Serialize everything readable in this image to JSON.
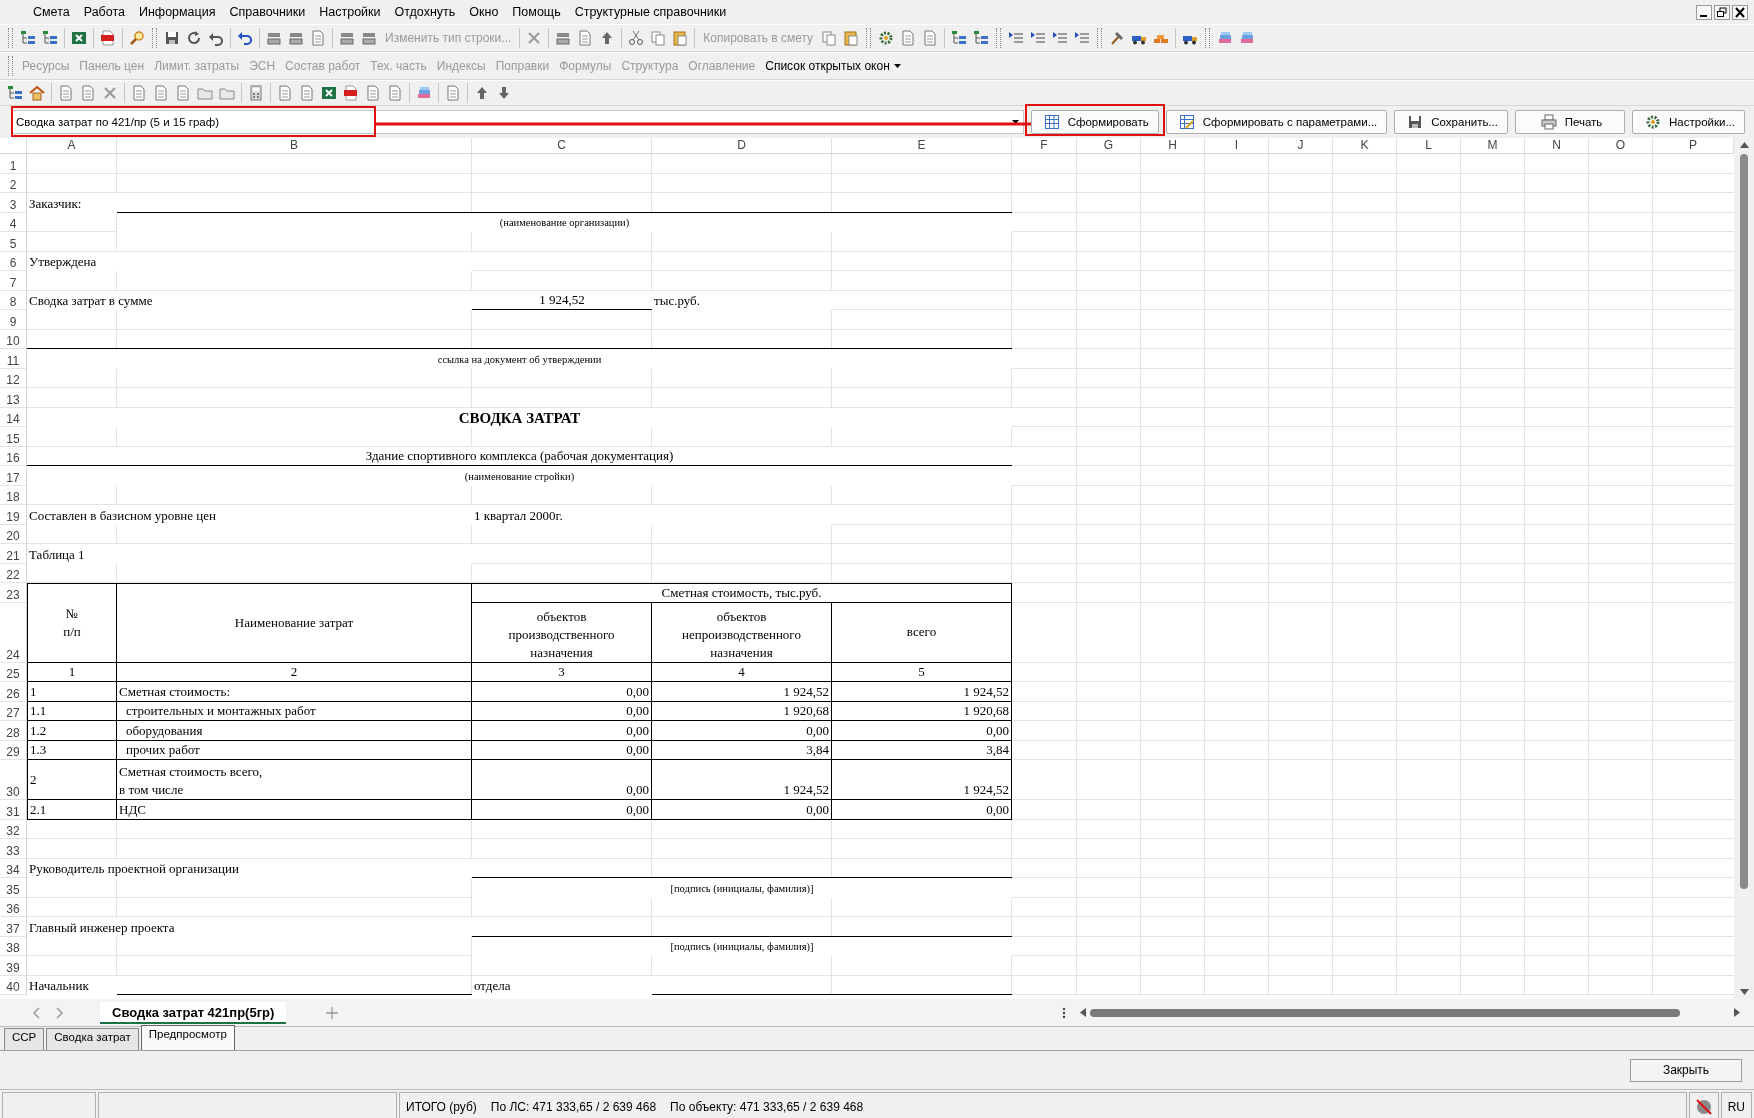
{
  "menu": [
    {
      "label": "Смета"
    },
    {
      "label": "Работа"
    },
    {
      "label": "Информация"
    },
    {
      "label": "Справочники"
    },
    {
      "label": "Настройки"
    },
    {
      "label": "Отдохнуть"
    },
    {
      "label": "Окно"
    },
    {
      "label": "Помощь"
    },
    {
      "label": "Структурные справочники"
    }
  ],
  "toolbar_main": [
    {
      "label": "Изменить тип строки...",
      "disabled": true
    },
    {
      "label": "Копировать в смету",
      "disabled": true
    }
  ],
  "toolbar_modules": [
    {
      "label": "Ресурсы",
      "disabled": true
    },
    {
      "label": "Панель цен",
      "disabled": true
    },
    {
      "label": "Лимит. затраты",
      "disabled": true
    },
    {
      "label": "ЭСН",
      "disabled": true
    },
    {
      "label": "Состав работ",
      "disabled": true
    },
    {
      "label": "Тех. часть",
      "disabled": true
    },
    {
      "label": "Индексы",
      "disabled": true
    },
    {
      "label": "Поправки",
      "disabled": true
    },
    {
      "label": "Формулы",
      "disabled": true
    },
    {
      "label": "Структура",
      "disabled": true
    },
    {
      "label": "Оглавление",
      "disabled": true
    },
    {
      "label": "Список открытых окон",
      "disabled": false
    }
  ],
  "report_selector": {
    "value": "Сводка затрат по 421/пр (5 и 15 граф)"
  },
  "report_buttons": [
    {
      "label": "Сформировать"
    },
    {
      "label": "Сформировать с параметрами..."
    },
    {
      "label": "Сохранить..."
    },
    {
      "label": "Печать"
    },
    {
      "label": "Настройки..."
    }
  ],
  "sheet": {
    "columns": [
      "A",
      "B",
      "C",
      "D",
      "E",
      "F",
      "G",
      "H",
      "I",
      "J",
      "K",
      "L",
      "M",
      "N",
      "O",
      "P"
    ],
    "rows": [
      {
        "number": "1"
      },
      {
        "number": "2"
      },
      {
        "number": "3",
        "cells": [
          "Заказчик:"
        ]
      },
      {
        "number": "4",
        "cells": [
          "(наименование организации)"
        ]
      },
      {
        "number": "5"
      },
      {
        "number": "6",
        "cells": [
          "Утверждена"
        ]
      },
      {
        "number": "7"
      },
      {
        "number": "8",
        "cells": [
          "Сводка затрат в сумме",
          "1 924,52",
          "тыс.руб."
        ]
      },
      {
        "number": "9"
      },
      {
        "number": "10"
      },
      {
        "number": "11",
        "cells": [
          "ссылка на документ об утверждении"
        ]
      },
      {
        "number": "12"
      },
      {
        "number": "13"
      },
      {
        "number": "14",
        "cells": [
          "СВОДКА ЗАТРАТ"
        ]
      },
      {
        "number": "15"
      },
      {
        "number": "16",
        "cells": [
          "Здание спортивного комплекса (рабочая документация)"
        ]
      },
      {
        "number": "17",
        "cells": [
          "(наименование стройки)"
        ]
      },
      {
        "number": "18"
      },
      {
        "number": "19",
        "cells": [
          "Составлен в базисном уровне цен",
          "1 квартал 2000г."
        ]
      },
      {
        "number": "20"
      },
      {
        "number": "21",
        "cells": [
          "Таблица 1"
        ]
      },
      {
        "number": "22"
      },
      {
        "number": "23",
        "cells": [
          "№\nп/п",
          "Наименование затрат",
          "Сметная стоимость, тыс.руб."
        ]
      },
      {
        "number": "24",
        "cells": [
          "объектов\nпроизводственного\nназначения",
          "объектов\nнепроизводственного\nназначения",
          "всего"
        ]
      },
      {
        "number": "25",
        "cells": [
          "1",
          "2",
          "3",
          "4",
          "5"
        ]
      },
      {
        "number": "26",
        "cells": [
          "1",
          "Сметная стоимость:",
          "0,00",
          "1 924,52",
          "1 924,52"
        ]
      },
      {
        "number": "27",
        "cells": [
          "1.1",
          "строительных и монтажных работ",
          "0,00",
          "1 920,68",
          "1 920,68"
        ]
      },
      {
        "number": "28",
        "cells": [
          "1.2",
          "оборудования",
          "0,00",
          "0,00",
          "0,00"
        ]
      },
      {
        "number": "29",
        "cells": [
          "1.3",
          "прочих работ",
          "0,00",
          "3,84",
          "3,84"
        ]
      },
      {
        "number": "30",
        "cells": [
          "2",
          "Сметная стоимость всего,\nв том числе",
          "0,00",
          "1 924,52",
          "1 924,52"
        ]
      },
      {
        "number": "31",
        "cells": [
          "2.1",
          "НДС",
          "0,00",
          "0,00",
          "0,00"
        ]
      },
      {
        "number": "32"
      },
      {
        "number": "33"
      },
      {
        "number": "34",
        "cells": [
          "Руководитель проектной организации"
        ]
      },
      {
        "number": "35",
        "cells": [
          "[подпись (инициалы, фамилия)]"
        ]
      },
      {
        "number": "36"
      },
      {
        "number": "37",
        "cells": [
          "Главный инженер проекта"
        ]
      },
      {
        "number": "38",
        "cells": [
          "[подпись (инициалы, фамилия)]"
        ]
      },
      {
        "number": "39"
      },
      {
        "number": "40",
        "cells": [
          "Начальник",
          "отдела"
        ]
      }
    ]
  },
  "sheet_tabs": [
    {
      "label": "Сводка затрат 421пр(5гр)",
      "selected": true
    }
  ],
  "view_tabs": [
    {
      "label": "ССР",
      "selected": false
    },
    {
      "label": "Сводка затрат",
      "selected": false
    },
    {
      "label": "Предпросмотр",
      "selected": true
    }
  ],
  "close_button": {
    "label": "Закрыть"
  },
  "status_bar": {
    "totals": [
      "ИТОГО (руб)",
      "По ЛС: 471 333,65 / 2 639 468",
      "По объекту: 471 333,65 / 2 639 468"
    ],
    "language": "RU"
  }
}
